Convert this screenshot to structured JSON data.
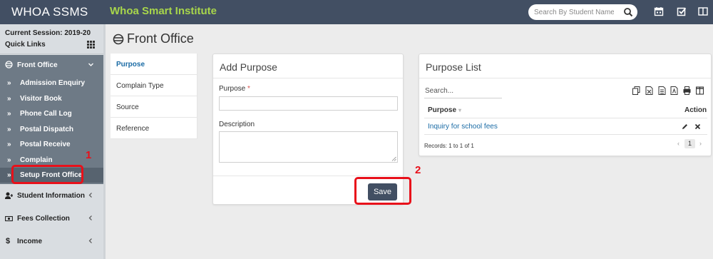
{
  "app": {
    "brand": "WHOA SSMS",
    "institute": "Whoa Smart Institute",
    "accent_color": "#a8d64b",
    "topbar_color": "#424f63"
  },
  "search": {
    "placeholder": "Search By Student Name",
    "icon": "search-icon"
  },
  "top_icons": [
    "calendar-icon",
    "checkbox-icon",
    "menu-icon"
  ],
  "sidebar": {
    "session": "Current Session: 2019-20",
    "quick_links": "Quick Links",
    "front_office": {
      "label": "Front Office",
      "items": [
        {
          "label": "Admission Enquiry"
        },
        {
          "label": "Visitor Book"
        },
        {
          "label": "Phone Call Log"
        },
        {
          "label": "Postal Dispatch"
        },
        {
          "label": "Postal Receive"
        },
        {
          "label": "Complain"
        },
        {
          "label": "Setup Front Office",
          "active": true
        }
      ]
    },
    "menu": [
      {
        "label": "Student Information",
        "icon": "user-plus-icon"
      },
      {
        "label": "Fees Collection",
        "icon": "money-icon"
      },
      {
        "label": "Income",
        "icon": "dollar-icon"
      }
    ]
  },
  "page": {
    "title": "Front Office"
  },
  "tabs": [
    {
      "label": "Purpose",
      "active": true
    },
    {
      "label": "Complain Type"
    },
    {
      "label": "Source"
    },
    {
      "label": "Reference"
    }
  ],
  "add_purpose": {
    "title": "Add Purpose",
    "purpose_label": "Purpose",
    "required_mark": "*",
    "purpose_value": "",
    "description_label": "Description",
    "description_value": "",
    "save_label": "Save"
  },
  "purpose_list": {
    "title": "Purpose List",
    "search_placeholder": "Search...",
    "columns": [
      "Purpose",
      "Action"
    ],
    "rows": [
      {
        "purpose": "Inquiry for school fees"
      }
    ],
    "records_text": "Records: 1 to 1 of 1",
    "current_page": "1"
  },
  "annotations": {
    "step1": "1",
    "step2": "2",
    "color": "#e8101a"
  }
}
